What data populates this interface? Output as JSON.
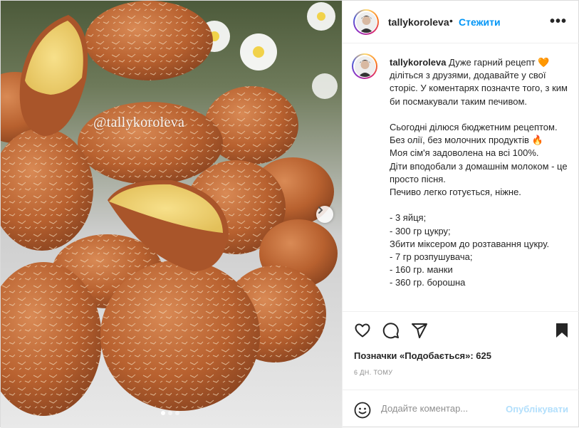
{
  "post": {
    "watermark": "@tallykoroleva",
    "carousel_dots": 3,
    "carousel_active": 0
  },
  "header": {
    "username": "tallykoroleva",
    "separator": "•",
    "follow_label": "Стежити",
    "more_label": "•••"
  },
  "caption": {
    "username": "tallykoroleva",
    "text": " Дуже гарний рецепт 🧡\nділіться з друзями, додавайте у свої сторіс. У коментарях позначте того, з ким би посмакували таким печивом.\n\nСьогодні ділюся бюджетним рецептом.\nБез олії, без молочних продуктів 🔥\nМоя сім'я задоволена на всі 100%.\nДіти вподобали з домашнім молоком - це просто пісня.\nПечиво легко готується, ніжне.\n\n- 3 яйця;\n- 300 гр цукру;\nЗбити міксером до розтавання цукру.\n- 7 гр розпушувача;\n- 160 гр. манки\n- 360 гр. борошна"
  },
  "actions": {
    "like_icon": "heart-icon",
    "comment_icon": "comment-icon",
    "share_icon": "paper-plane-icon",
    "save_icon": "bookmark-icon"
  },
  "likes": {
    "text": "Позначки «Подобається»: 625"
  },
  "date": {
    "text": "6 ДН. ТОМУ"
  },
  "comment": {
    "placeholder": "Додайте коментар...",
    "publish_label": "Опублікувати"
  },
  "colors": {
    "accent": "#0095f6",
    "publish_disabled": "#b2dffc",
    "cookie": "#c06a3a"
  }
}
